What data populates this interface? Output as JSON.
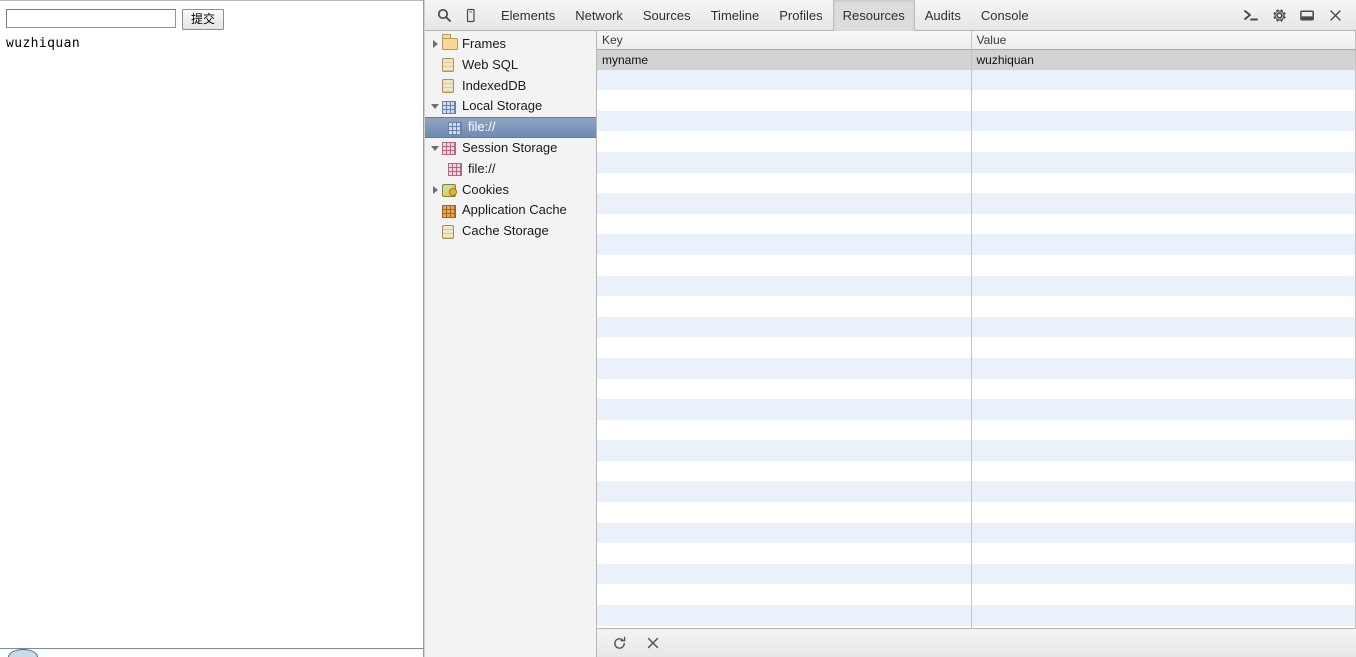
{
  "page": {
    "input_value": "",
    "input_placeholder": "",
    "submit_label": "提交",
    "output_text": "wuzhiquan"
  },
  "devtools": {
    "toolbar": {
      "inspect_icon": "search-icon",
      "device_icon": "mobile-device-icon",
      "tabs": [
        {
          "label": "Elements",
          "active": false
        },
        {
          "label": "Network",
          "active": false
        },
        {
          "label": "Sources",
          "active": false
        },
        {
          "label": "Timeline",
          "active": false
        },
        {
          "label": "Profiles",
          "active": false
        },
        {
          "label": "Resources",
          "active": true
        },
        {
          "label": "Audits",
          "active": false
        },
        {
          "label": "Console",
          "active": false
        }
      ],
      "right_icons": [
        {
          "name": "console-prompt-icon",
          "glyph": ">_"
        },
        {
          "name": "settings-gear-icon",
          "glyph": "gear"
        },
        {
          "name": "dock-position-icon",
          "glyph": "dock"
        },
        {
          "name": "close-devtools-icon",
          "glyph": "×"
        }
      ]
    },
    "sidebar": {
      "items": [
        {
          "label": "Frames",
          "icon": "folder-icon",
          "twisty": "right",
          "indent": 0,
          "selected": false
        },
        {
          "label": "Web SQL",
          "icon": "database-icon",
          "twisty": "none",
          "indent": 0,
          "selected": false
        },
        {
          "label": "IndexedDB",
          "icon": "database-icon",
          "twisty": "none",
          "indent": 0,
          "selected": false
        },
        {
          "label": "Local Storage",
          "icon": "storage-grid-icon",
          "twisty": "down",
          "indent": 0,
          "selected": false
        },
        {
          "label": "file://",
          "icon": "storage-grid-icon",
          "twisty": "none",
          "indent": 1,
          "selected": true
        },
        {
          "label": "Session Storage",
          "icon": "session-grid-icon",
          "twisty": "down",
          "indent": 0,
          "selected": false
        },
        {
          "label": "file://",
          "icon": "session-grid-icon",
          "twisty": "none",
          "indent": 1,
          "selected": false
        },
        {
          "label": "Cookies",
          "icon": "cookie-icon",
          "twisty": "right",
          "indent": 0,
          "selected": false
        },
        {
          "label": "Application Cache",
          "icon": "appcache-grid-icon",
          "twisty": "none",
          "indent": 0,
          "selected": false
        },
        {
          "label": "Cache Storage",
          "icon": "database-icon",
          "twisty": "none",
          "indent": 0,
          "selected": false
        }
      ]
    },
    "table": {
      "columns": [
        "Key",
        "Value"
      ],
      "rows": [
        {
          "key": "myname",
          "value": "wuzhiquan",
          "selected": true
        }
      ],
      "empty_row_count": 28
    },
    "bottom_toolbar": {
      "icons": [
        {
          "name": "refresh-icon",
          "glyph": "↻"
        },
        {
          "name": "delete-icon",
          "glyph": "×"
        }
      ]
    }
  }
}
